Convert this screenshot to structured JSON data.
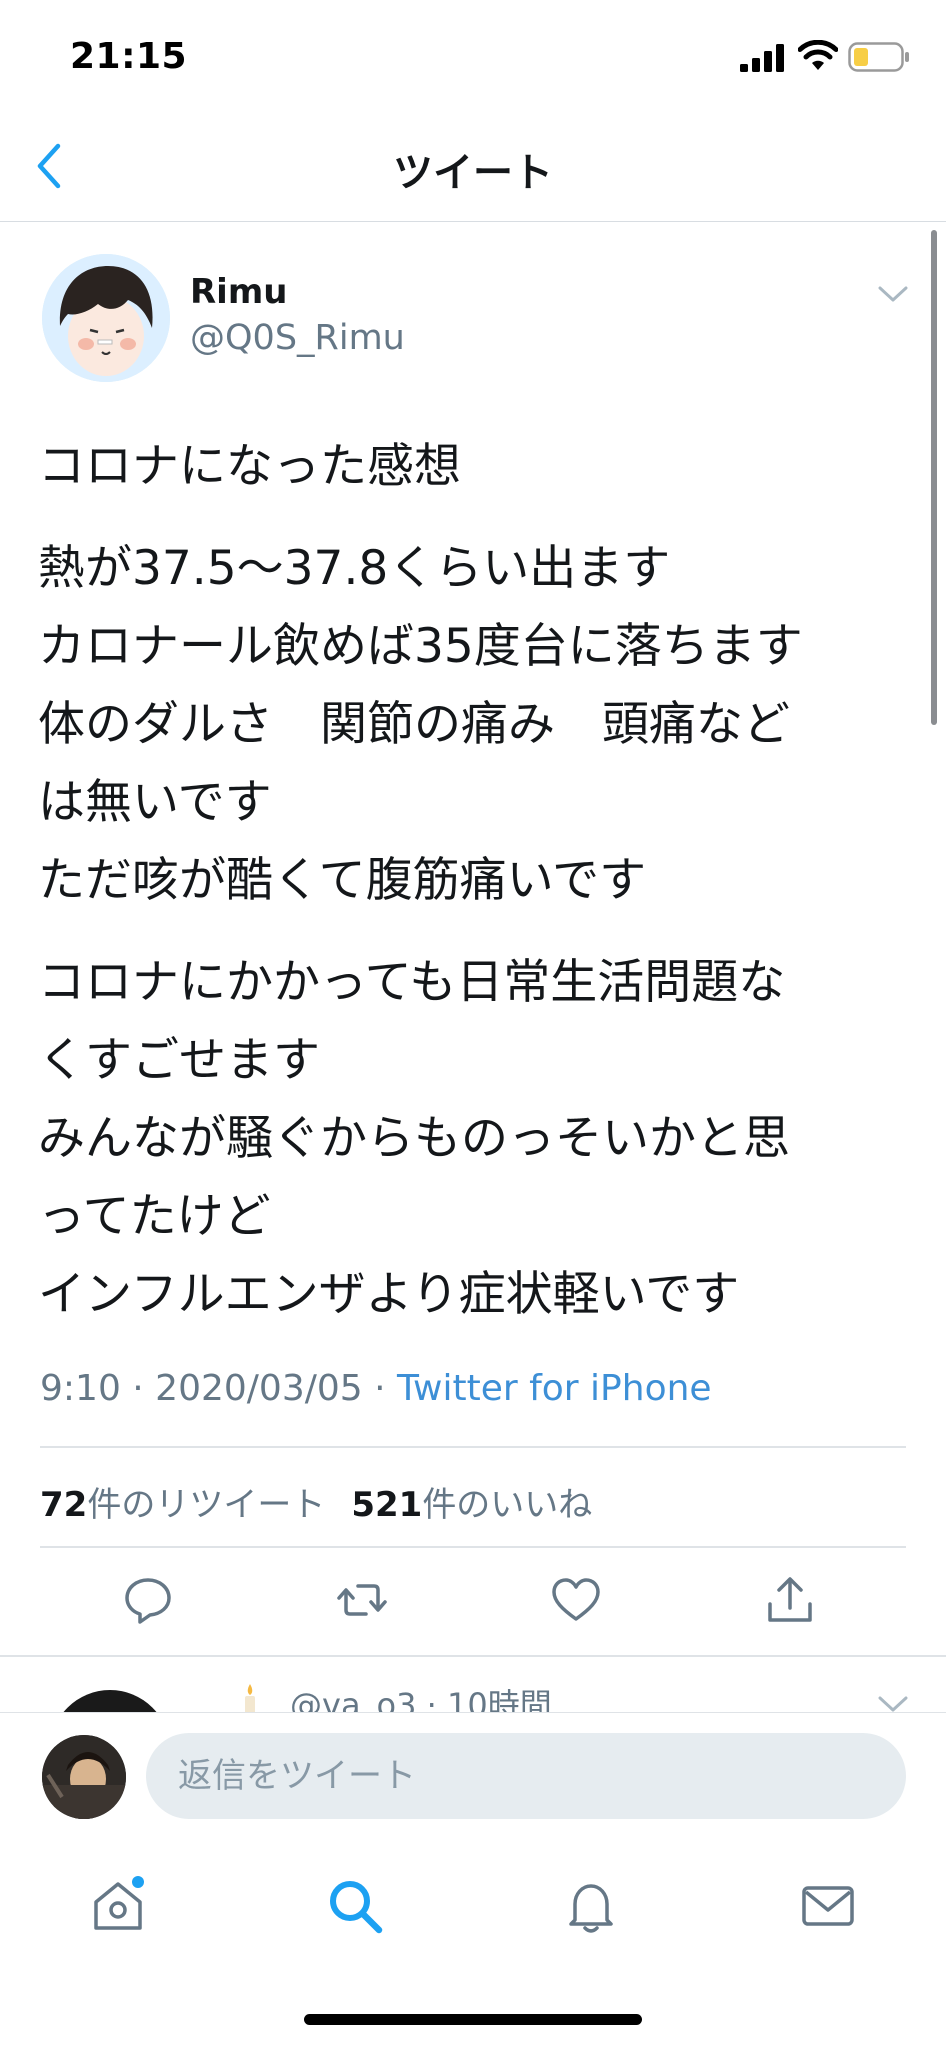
{
  "status_bar": {
    "time": "21:15",
    "icons": [
      "signal-icon",
      "wifi-icon",
      "battery-icon"
    ],
    "battery_color": "#f7ce46"
  },
  "nav": {
    "title": "ツイート",
    "back_icon": "chevron-left-icon"
  },
  "tweet": {
    "author": {
      "name": "Rimu",
      "handle": "@Q0S_Rimu"
    },
    "body": [
      [
        "コロナになった感想"
      ],
      [
        "熱が37.5〜37.8くらい出ます",
        "カロナール飲めば35度台に落ちます",
        "体のダルさ　関節の痛み　頭痛など",
        "は無いです",
        "ただ咳が酷くて腹筋痛いです"
      ],
      [
        "コロナにかかっても日常生活問題な",
        "くすごせます",
        "みんなが騒ぐからものっそいかと思",
        "ってたけど",
        "インフルエンザより症状軽いです"
      ]
    ],
    "meta": {
      "timestamp": "9:10 · 2020/03/05 · ",
      "source": "Twitter for iPhone"
    },
    "stats": {
      "retweets_count": "72",
      "retweets_label": "件のリツイート",
      "likes_count": "521",
      "likes_label": "件のいいね"
    },
    "actions": [
      "reply-icon",
      "retweet-icon",
      "like-icon",
      "share-icon"
    ]
  },
  "reply_preview": {
    "meta": "@va_o3 · 10時間"
  },
  "compose": {
    "placeholder": "返信をツイート"
  },
  "tab_bar": {
    "items": [
      "home-icon",
      "search-icon",
      "notifications-icon",
      "messages-icon"
    ],
    "active": "search-icon"
  },
  "colors": {
    "accent": "#1da1f2",
    "link": "#3d8fd6",
    "secondary_text": "#657786",
    "icon_gray": "#657786"
  }
}
